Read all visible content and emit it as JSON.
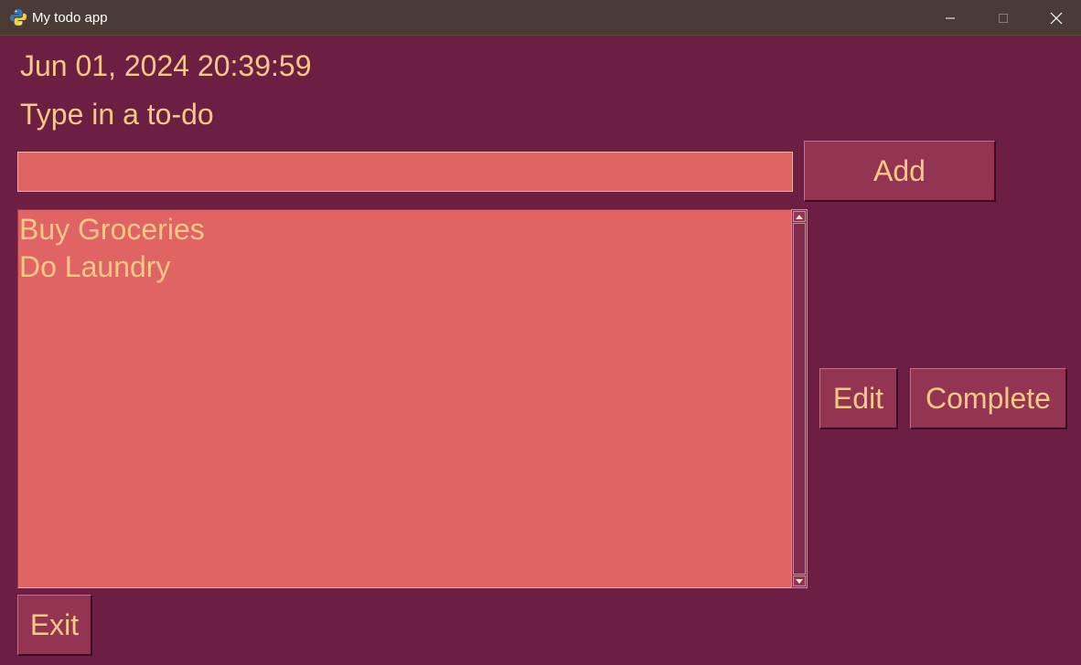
{
  "window": {
    "title": "My todo app",
    "icon": "python-icon"
  },
  "header": {
    "datetime": "Jun 01, 2024 20:39:59",
    "prompt": "Type in a to-do"
  },
  "input": {
    "value": "",
    "placeholder": ""
  },
  "buttons": {
    "add_label": "Add",
    "edit_label": "Edit",
    "complete_label": "Complete",
    "exit_label": "Exit"
  },
  "todos": {
    "items": [
      {
        "label": "Buy Groceries"
      },
      {
        "label": "Do Laundry"
      }
    ]
  },
  "colors": {
    "background": "#6d1f43",
    "field": "#e06464",
    "button": "#933552",
    "text": "#f6c886",
    "titlebar": "#4a3c35"
  }
}
